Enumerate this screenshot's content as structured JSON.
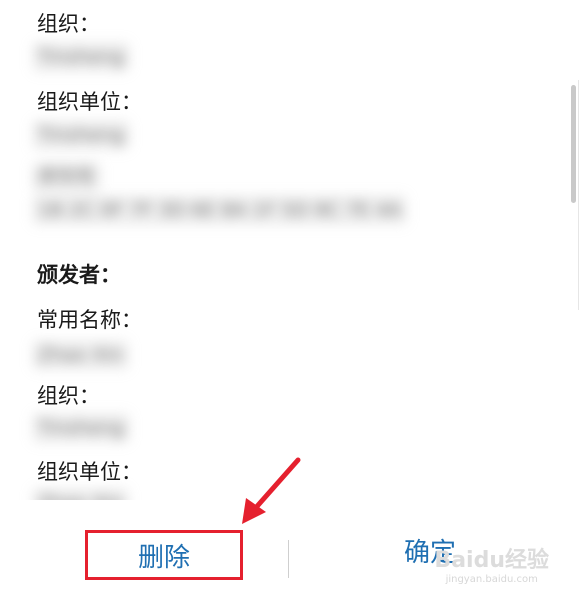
{
  "cert": {
    "subject_org_label": "组织：",
    "subject_org_value": "Tinsheng",
    "subject_unit_label": "组织单位：",
    "subject_unit_value": "Tinsheng",
    "blurred_field_label": "序列号",
    "blurred_field_value": "1B 2C 0F 7F 3D 6E 8A 1F 5D 9C 7E 4A",
    "issuer_heading": "颁发者：",
    "issuer_cn_label": "常用名称：",
    "issuer_cn_value": "Zhao Xin",
    "issuer_org_label": "组织：",
    "issuer_org_value": "Tinsheng",
    "issuer_unit_label": "组织单位：",
    "issuer_unit_value": "Zhao Xin"
  },
  "buttons": {
    "delete": "删除",
    "confirm": "确定"
  },
  "watermark": {
    "logo": "Baidu经验",
    "url": "jingyan.baidu.com"
  },
  "colors": {
    "accent": "#1f6fb2",
    "highlight": "#e5202e"
  }
}
